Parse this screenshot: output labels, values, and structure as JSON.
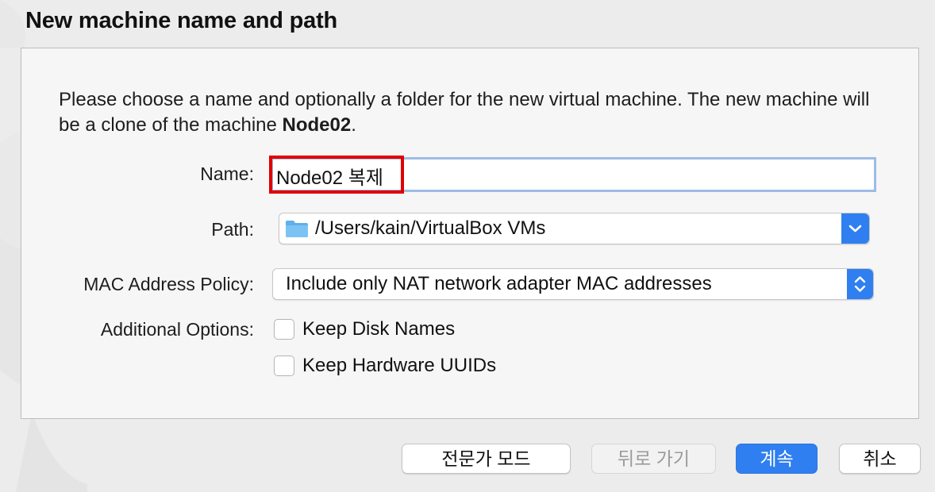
{
  "dialog": {
    "title": "New machine name and path",
    "description_prefix": "Please choose a name and optionally a folder for the new virtual machine. The new machine will be a clone of the machine ",
    "source_machine": "Node02",
    "description_suffix": "."
  },
  "form": {
    "name_label": "Name:",
    "name_value": "Node02 복제",
    "path_label": "Path:",
    "path_value": "/Users/kain/VirtualBox VMs",
    "mac_label": "MAC Address Policy:",
    "mac_value": "Include only NAT network adapter MAC addresses",
    "options_label": "Additional Options:",
    "options": [
      {
        "label": "Keep Disk Names",
        "checked": false
      },
      {
        "label": "Keep Hardware UUIDs",
        "checked": false
      }
    ]
  },
  "buttons": {
    "expert": "전문가 모드",
    "back": "뒤로 가기",
    "continue": "계속",
    "cancel": "취소"
  },
  "icons": {
    "path_folder": "folder-icon",
    "path_dropdown": "chevron-down-icon",
    "mac_dropdown": "up-down-chevron-icon"
  },
  "colors": {
    "accent": "#2f7ff0",
    "highlight": "#e00000",
    "focus_ring": "#9dbbe6"
  }
}
